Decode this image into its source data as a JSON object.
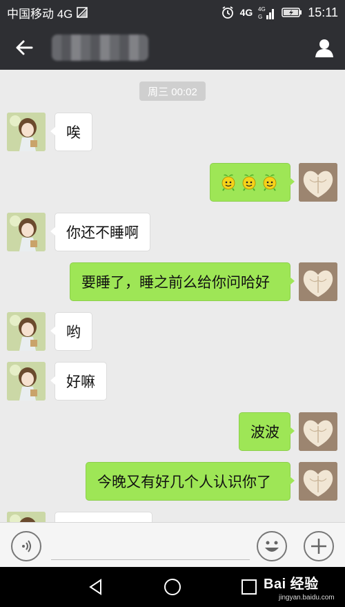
{
  "status_bar": {
    "carrier": "中国移动 4G",
    "network_badge": "4G",
    "time": "15:11",
    "icons": [
      "signal-image-icon",
      "alarm-icon",
      "4g-signal-icon",
      "battery-icon"
    ]
  },
  "nav": {
    "back_icon": "arrow-left-icon",
    "contact_name": "",
    "profile_icon": "person-icon"
  },
  "chat": {
    "timestamp": "周三 00:02",
    "messages": [
      {
        "side": "left",
        "text": "唉"
      },
      {
        "side": "right",
        "text": "",
        "emoji": [
          "smiley-sprout-emoji",
          "smiley-sprout-emoji",
          "smiley-sprout-emoji"
        ]
      },
      {
        "side": "left",
        "text": "你还不睡啊"
      },
      {
        "side": "right",
        "text": "要睡了，睡之前么给你问哈好"
      },
      {
        "side": "left",
        "text": "哟"
      },
      {
        "side": "left",
        "text": "好嘛"
      },
      {
        "side": "right",
        "text": "波波"
      },
      {
        "side": "right",
        "text": "今晚又有好几个人认识你了"
      },
      {
        "side": "left",
        "text": ""
      }
    ]
  },
  "input_bar": {
    "voice_icon": "voice-icon",
    "input_value": "",
    "emoji_icon": "smiley-icon",
    "plus_icon": "plus-icon"
  },
  "system_nav": {
    "back_icon": "triangle-back-icon",
    "home_icon": "circle-home-icon",
    "recents_icon": "square-recents-icon"
  },
  "watermark": {
    "main": "Bai 经验",
    "sub": "jingyan.baidu.com"
  },
  "colors": {
    "bar_bg": "#2e2f33",
    "chat_bg": "#ebebeb",
    "bubble_green": "#9ee656",
    "bubble_white": "#ffffff"
  }
}
